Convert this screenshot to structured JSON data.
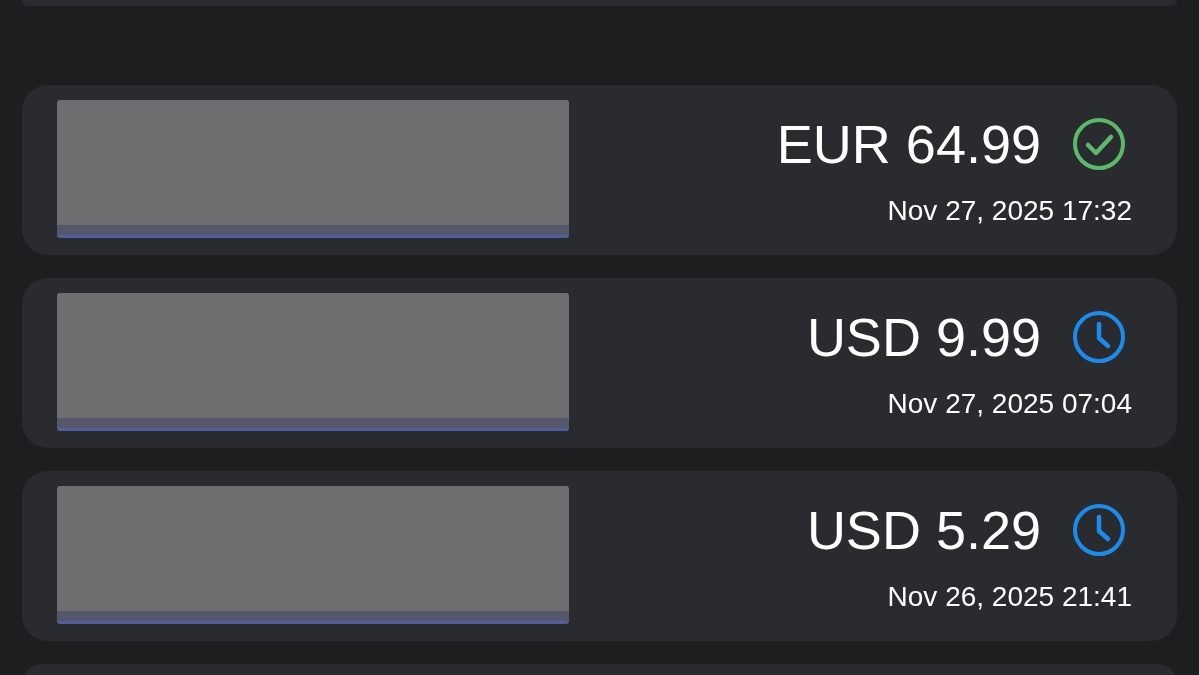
{
  "transactions": [
    {
      "amount": "EUR 64.99",
      "date": "Nov 27, 2025 17:32",
      "completed": true
    },
    {
      "amount": "USD 9.99",
      "date": "Nov 27, 2025 07:04",
      "completed": false
    },
    {
      "amount": "USD 5.29",
      "date": "Nov 26, 2025 21:41",
      "completed": false
    }
  ]
}
